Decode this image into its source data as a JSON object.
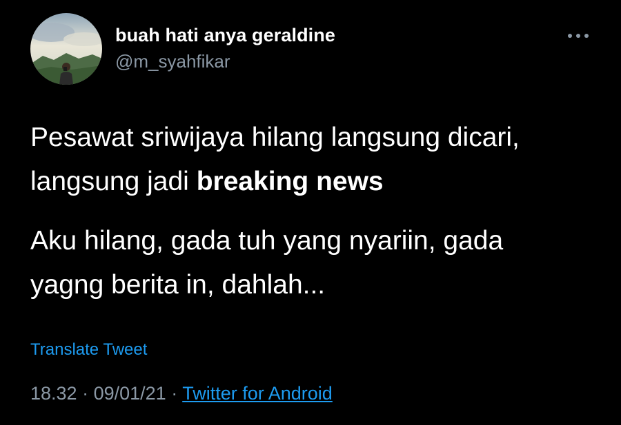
{
  "user": {
    "display_name": "buah hati anya geraldine",
    "handle": "@m_syahfikar",
    "avatar_icon": "profile-photo-landscape"
  },
  "more_icon": "ellipsis-icon",
  "tweet": {
    "line1_part1": "Pesawat sriwijaya hilang langsung dicari,",
    "line1_part2": "langsung jadi ",
    "line1_bold": "breaking news",
    "para2_line1": "Aku hilang, gada tuh yang nyariin, gada",
    "para2_line2": "yagng berita in, dahlah..."
  },
  "translate_label": "Translate Tweet",
  "meta": {
    "time": "18.32",
    "separator": " · ",
    "date": "09/01/21",
    "source": "Twitter for Android"
  },
  "colors": {
    "background": "#000000",
    "text": "#ffffff",
    "secondary": "#8b98a5",
    "link": "#1d9bf0"
  }
}
